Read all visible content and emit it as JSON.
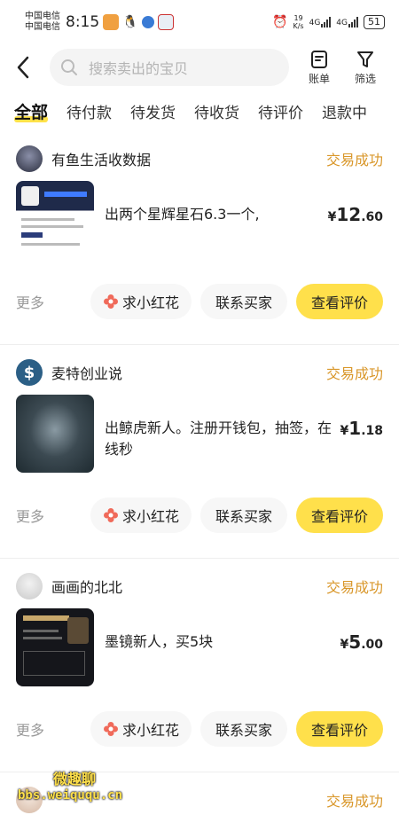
{
  "status_bar": {
    "carrier_1": "中国电信",
    "carrier_2": "中国电信",
    "time": "8:15",
    "net_speed_value": "19",
    "net_speed_unit": "K/s",
    "net_1": "4G",
    "net_2": "4G",
    "battery": "51"
  },
  "header": {
    "search_placeholder": "搜索卖出的宝贝",
    "bill_label": "账单",
    "filter_label": "筛选"
  },
  "tabs": [
    {
      "label": "全部",
      "active": true
    },
    {
      "label": "待付款"
    },
    {
      "label": "待发货"
    },
    {
      "label": "待收货"
    },
    {
      "label": "待评价"
    },
    {
      "label": "退款中"
    }
  ],
  "orders": [
    {
      "shop": "有鱼生活收数据",
      "status": "交易成功",
      "description": "出两个星辉星石6.3一个,",
      "price_yen": "¥",
      "price_int": "12",
      "price_dec": ".60",
      "more": "更多",
      "flower_label": "求小红花",
      "contact_label": "联系买家",
      "review_label": "查看评价"
    },
    {
      "shop": "麦特创业说",
      "status": "交易成功",
      "description": "出鲸虎新人。注册开钱包，抽签，在线秒",
      "price_yen": "¥",
      "price_int": "1",
      "price_dec": ".18",
      "more": "更多",
      "flower_label": "求小红花",
      "contact_label": "联系买家",
      "review_label": "查看评价"
    },
    {
      "shop": "画画的北北",
      "status": "交易成功",
      "description": "墨镜新人，买5块",
      "price_yen": "¥",
      "price_int": "5",
      "price_dec": ".00",
      "more": "更多",
      "flower_label": "求小红花",
      "contact_label": "联系买家",
      "review_label": "查看评价"
    },
    {
      "shop": "",
      "status": "交易成功"
    }
  ],
  "watermark": {
    "line1": "微趣聊",
    "line2": "bbs.weiququ.cn"
  },
  "colors": {
    "accent_yellow": "#ffe04b",
    "status_orange": "#d9972a"
  }
}
